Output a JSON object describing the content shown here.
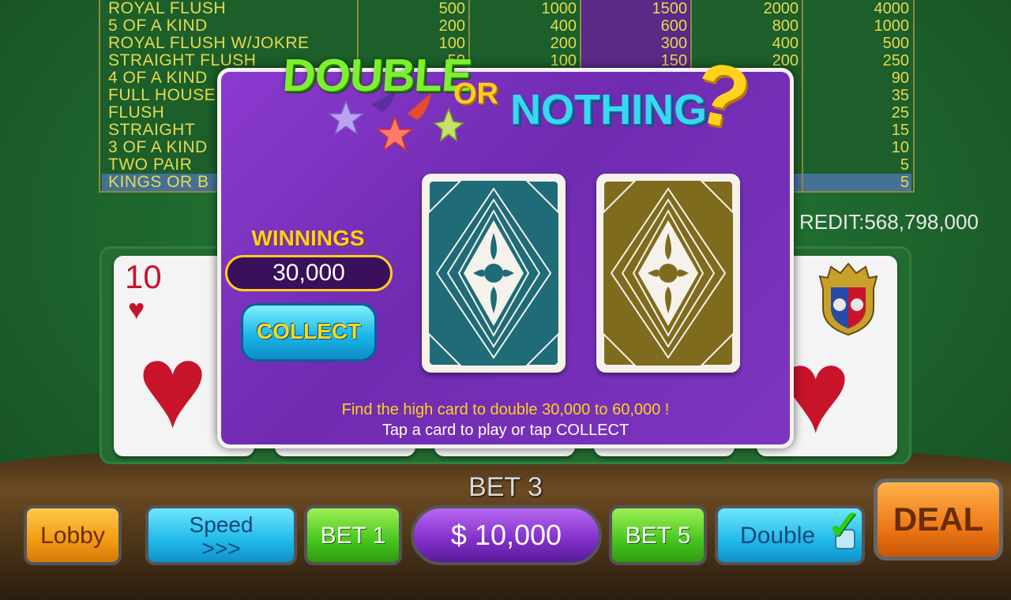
{
  "paytable": {
    "rows": [
      {
        "name": "ROYAL FLUSH",
        "values": [
          "500",
          "1000",
          "1500",
          "2000",
          "4000"
        ]
      },
      {
        "name": "5 OF A KIND",
        "values": [
          "200",
          "400",
          "600",
          "800",
          "1000"
        ]
      },
      {
        "name": "ROYAL FLUSH W/JOKRE",
        "values": [
          "100",
          "200",
          "300",
          "400",
          "500"
        ]
      },
      {
        "name": "STRAIGHT FLUSH",
        "values": [
          "50",
          "100",
          "150",
          "200",
          "250"
        ]
      },
      {
        "name": "4 OF A KIND",
        "values": [
          "",
          "",
          "",
          "",
          "90"
        ]
      },
      {
        "name": "FULL HOUSE",
        "values": [
          "",
          "",
          "",
          "",
          "35"
        ]
      },
      {
        "name": "FLUSH",
        "values": [
          "",
          "",
          "",
          "",
          "25"
        ]
      },
      {
        "name": "STRAIGHT",
        "values": [
          "",
          "",
          "",
          "",
          "15"
        ]
      },
      {
        "name": "3 OF A KIND",
        "values": [
          "",
          "",
          "",
          "",
          "10"
        ]
      },
      {
        "name": "TWO PAIR",
        "values": [
          "",
          "",
          "",
          "",
          "5"
        ]
      },
      {
        "name": "KINGS OR B",
        "values": [
          "",
          "",
          "",
          "",
          "5"
        ]
      }
    ]
  },
  "credit": "REDIT:568,798,000",
  "hand": {
    "card1": {
      "rank": "10",
      "suit": "♥"
    },
    "card5": {
      "suit": "♥"
    }
  },
  "modal": {
    "title_double": "DOUBLE",
    "title_or": "OR",
    "title_nothing": "NOTHING",
    "title_question": "?",
    "winnings_label": "WINNINGS",
    "winnings_value": "30,000",
    "collect_label": "COLLECT",
    "message_line1": "Find the high card to double 30,000 to 60,000 !",
    "message_line2": "Tap a card to play or tap COLLECT",
    "card_back_colors": [
      "#1f6b78",
      "#7f6b1e"
    ]
  },
  "bet_label": "BET 3",
  "buttons": {
    "lobby": "Lobby",
    "speed_line1": "Speed",
    "speed_line2": ">>>",
    "bet1": "BET 1",
    "balance": "$ 10,000",
    "bet5": "BET 5",
    "double": "Double",
    "deal": "DEAL"
  }
}
